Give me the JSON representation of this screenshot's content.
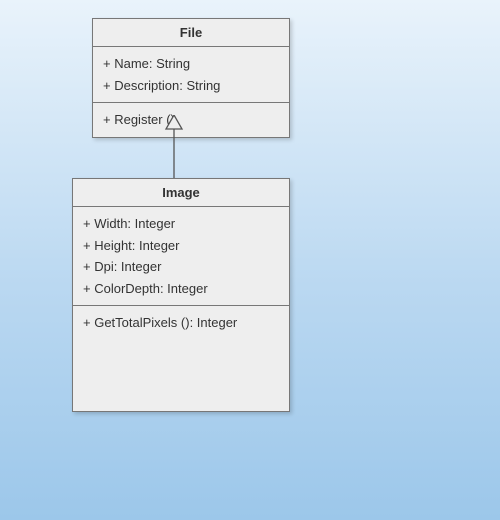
{
  "diagram": {
    "type": "uml-class",
    "relationship": "generalization",
    "classes": {
      "file": {
        "name": "File",
        "attributes": [
          "+ Name: String",
          "+ Description: String"
        ],
        "operations": [
          "+ Register ()"
        ]
      },
      "image": {
        "name": "Image",
        "attributes": [
          "+ Width: Integer",
          "+ Height: Integer",
          "+ Dpi: Integer",
          "+ ColorDepth: Integer"
        ],
        "operations": [
          "+ GetTotalPixels (): Integer"
        ]
      }
    }
  }
}
